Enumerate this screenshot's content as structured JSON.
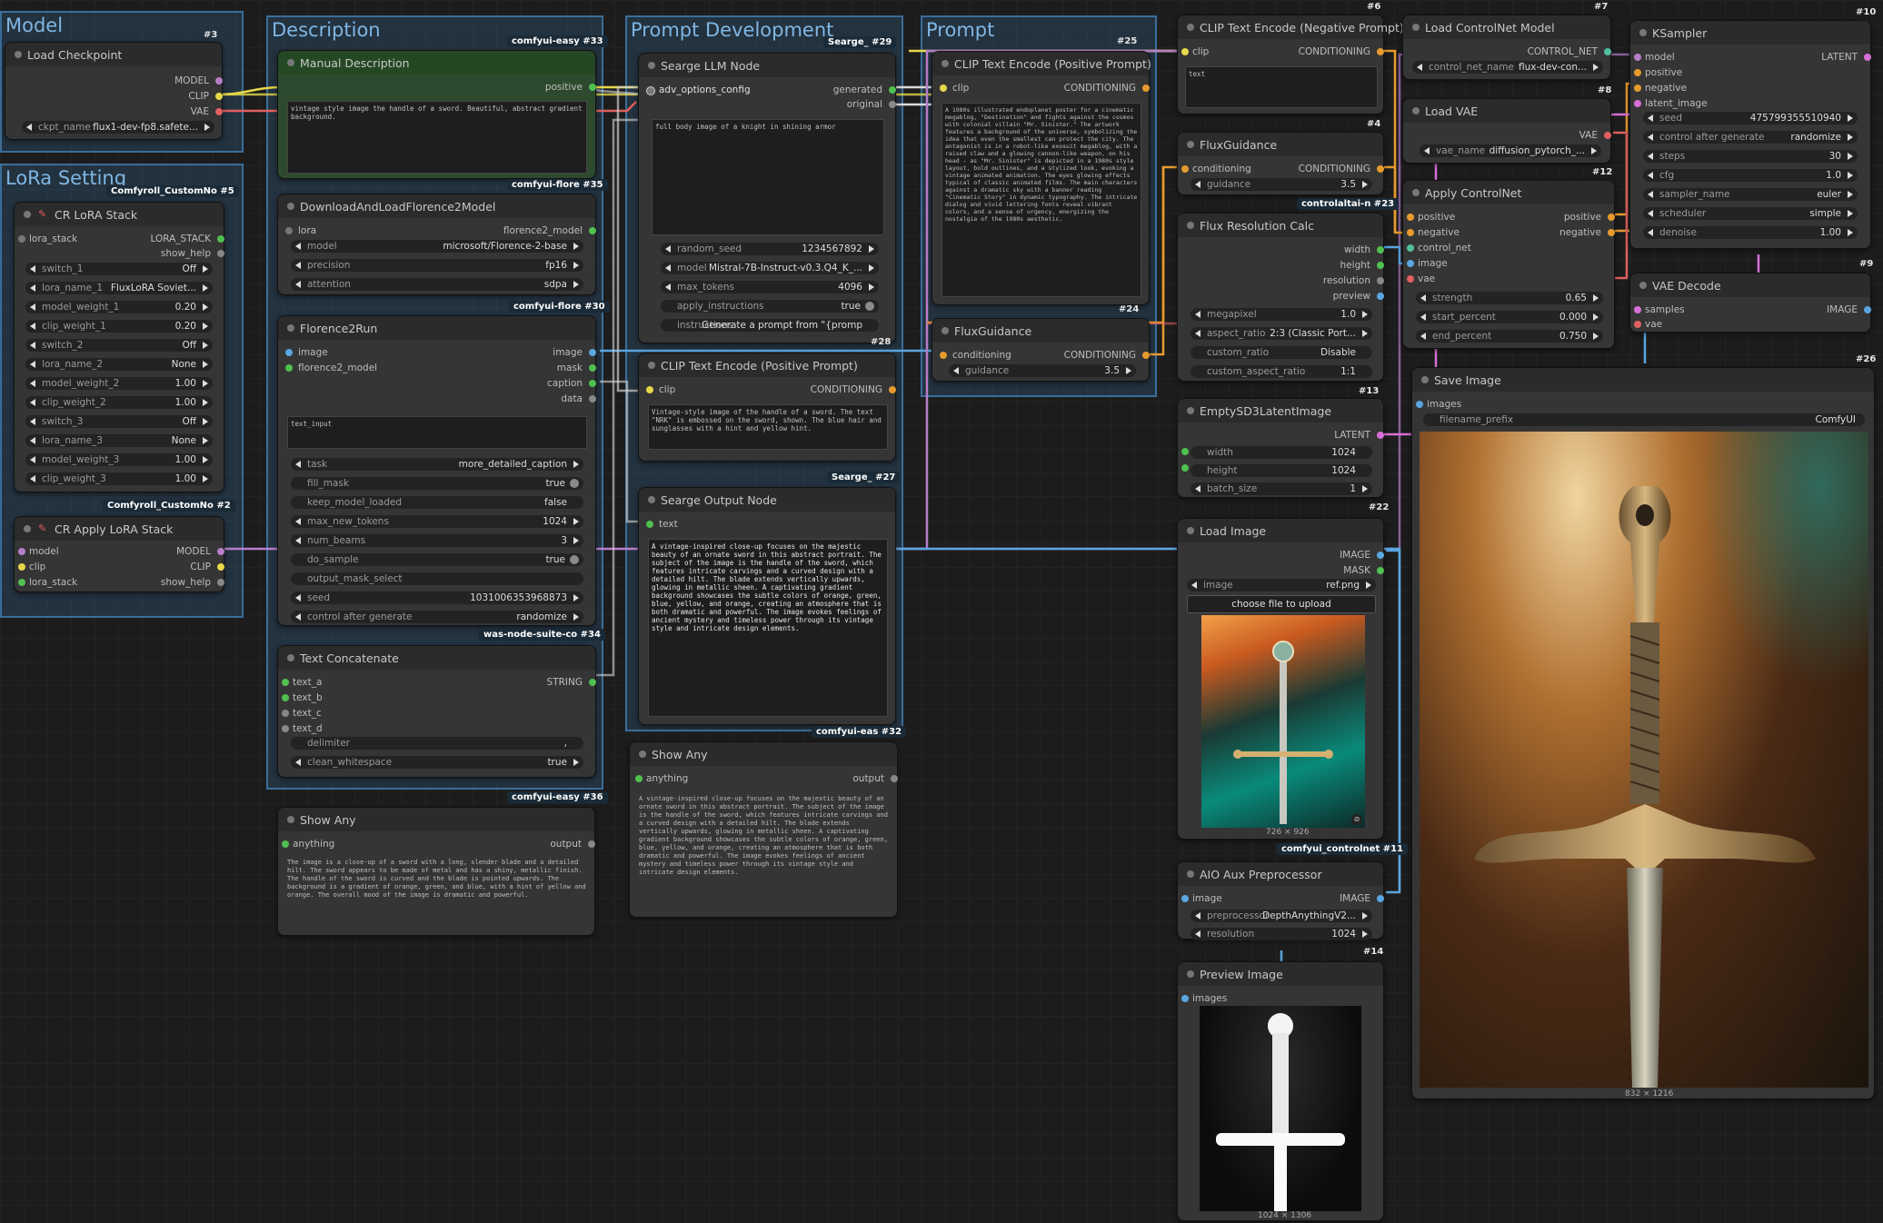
{
  "groups": {
    "model": "Model",
    "lora": "LoRa Setting",
    "description": "Description",
    "prompt_dev": "Prompt Development",
    "prompt": "Prompt"
  },
  "badges": {
    "b3": "#3",
    "b5": "Comfyroll_CustomNo #5",
    "b2": "Comfyroll_CustomNo #2",
    "b33": "comfyui-easy #33",
    "b35": "comfyui-flore #35",
    "b30": "comfyui-flore #30",
    "b34": "was-node-suite-co #34",
    "b36": "comfyui-easy #36",
    "b29": "Searge_ #29",
    "b28": "#28",
    "b27": "Searge_ #27",
    "b32": "comfyui-eas #32",
    "b25": "#25",
    "b24": "#24",
    "b6": "#6",
    "b4": "#4",
    "b23": "controlaltai-n #23",
    "b13": "#13",
    "b22": "#22",
    "b11": "comfyui_controlnet #11",
    "b14": "#14",
    "b7": "#7",
    "b8": "#8",
    "b12": "#12",
    "b10": "#10",
    "b9": "#9",
    "b26": "#26"
  },
  "nodes": {
    "load_checkpoint": {
      "title": "Load Checkpoint",
      "out_model": "MODEL",
      "out_clip": "CLIP",
      "out_vae": "VAE",
      "ckpt_label": "ckpt_name",
      "ckpt_value": "flux1-dev-fp8.safete..."
    },
    "cr_lora_stack": {
      "title": "CR LoRA Stack",
      "in_lora": "lora_stack",
      "out_lora": "LORA_STACK",
      "out_help": "show_help",
      "widgets": [
        [
          "switch_1",
          "Off"
        ],
        [
          "lora_name_1",
          "FluxLoRA Soviet..."
        ],
        [
          "model_weight_1",
          "0.20"
        ],
        [
          "clip_weight_1",
          "0.20"
        ],
        [
          "switch_2",
          "Off"
        ],
        [
          "lora_name_2",
          "None"
        ],
        [
          "model_weight_2",
          "1.00"
        ],
        [
          "clip_weight_2",
          "1.00"
        ],
        [
          "switch_3",
          "Off"
        ],
        [
          "lora_name_3",
          "None"
        ],
        [
          "model_weight_3",
          "1.00"
        ],
        [
          "clip_weight_3",
          "1.00"
        ]
      ]
    },
    "cr_apply_lora": {
      "title": "CR Apply LoRA Stack",
      "in_model": "model",
      "in_clip": "clip",
      "in_lora": "lora_stack",
      "out_model": "MODEL",
      "out_clip": "CLIP",
      "out_help": "show_help"
    },
    "manual_desc": {
      "title": "Manual Description",
      "out": "positive",
      "text": "vintage style image the handle of a sword. Beautiful, abstract gradient background."
    },
    "dl_florence": {
      "title": "DownloadAndLoadFlorence2Model",
      "in_lora": "lora",
      "out": "florence2_model",
      "widgets": [
        [
          "model",
          "microsoft/Florence-2-base"
        ],
        [
          "precision",
          "fp16"
        ],
        [
          "attention",
          "sdpa"
        ]
      ]
    },
    "florence_run": {
      "title": "Florence2Run",
      "in_image": "image",
      "in_model": "florence2_model",
      "out_image": "image",
      "out_mask": "mask",
      "out_caption": "caption",
      "out_data": "data",
      "text_input": "text_input",
      "widgets": [
        [
          "task",
          "more_detailed_caption"
        ],
        [
          "fill_mask",
          "true"
        ],
        [
          "keep_model_loaded",
          "false"
        ],
        [
          "max_new_tokens",
          "1024"
        ],
        [
          "num_beams",
          "3"
        ],
        [
          "do_sample",
          "true"
        ],
        [
          "output_mask_select",
          ""
        ],
        [
          "seed",
          "1031006353968873"
        ],
        [
          "control after generate",
          "randomize"
        ]
      ]
    },
    "text_concat": {
      "title": "Text Concatenate",
      "inputs": [
        "text_a",
        "text_b",
        "text_c",
        "text_d"
      ],
      "out": "STRING",
      "widgets": [
        [
          "delimiter",
          ","
        ],
        [
          "clean_whitespace",
          "true"
        ]
      ]
    },
    "show_any_1": {
      "title": "Show Any",
      "in": "anything",
      "out": "output",
      "text": "The image is a close-up of a sword with a long, slender blade and a detailed hilt. The sword appears to be made of metal and has a shiny, metallic finish. The handle of the sword is curved and the blade is pointed upwards. The background is a gradient of orange, green, and blue, with a hint of yellow and orange. The overall mood of the image is dramatic and powerful."
    },
    "searge_llm": {
      "title": "Searge LLM Node",
      "in_adv": "adv_options_config",
      "out_gen": "generated",
      "out_orig": "original",
      "text": "full body image of a knight in shining armor",
      "widgets": [
        [
          "random_seed",
          "1234567892"
        ],
        [
          "model",
          "Mistral-7B-Instruct-v0.3.Q4_K_..."
        ],
        [
          "max_tokens",
          "4096"
        ],
        [
          "apply_instructions",
          "true"
        ],
        [
          "instructions",
          "Generate a prompt from \"{promp"
        ]
      ]
    },
    "clip_pos_28": {
      "title": "CLIP Text Encode (Positive Prompt)",
      "in_clip": "clip",
      "out": "CONDITIONING",
      "text": "Vintage-style image of the handle of a sword. The text \"NRK\" is embossed on the sword, shown. The blue hair and sunglasses with a hint and yellow hint."
    },
    "searge_out": {
      "title": "Searge Output Node",
      "in": "text",
      "text": "A vintage-inspired close-up focuses on the majestic beauty of an ornate sword in this abstract portrait. The subject of the image is the handle of the sword, which features intricate carvings and a curved design with a detailed hilt. The blade extends vertically upwards, glowing in metallic sheen. A captivating gradient background showcases the subtle colors of orange, green, blue, yellow, and orange, creating an atmosphere that is both dramatic and powerful. The image evokes feelings of ancient mystery and timeless power through its vintage style and intricate design elements."
    },
    "show_any_2": {
      "title": "Show Any",
      "in": "anything",
      "out": "output",
      "text": "A vintage-inspired close-up focuses on the majestic beauty of an ornate sword in this abstract portrait. The subject of the image is the handle of the sword, which features intricate carvings and a curved design with a detailed hilt. The blade extends vertically upwards, glowing in metallic sheen. A captivating gradient background showcases the subtle colors of orange, green, blue, yellow, and orange, creating an atmosphere that is both dramatic and powerful. The image evokes feelings of ancient mystery and timeless power through its vintage style and intricate design elements."
    },
    "clip_pos_25": {
      "title": "CLIP Text Encode (Positive Prompt)",
      "in_clip": "clip",
      "out": "CONDITIONING",
      "text": "A 1980s illustrated endoplanet poster for a cinematic megablog, \"Destination\" and fights against the cosmos with colonial villain \"Mr. Sinister.\" The artwork features a background of the universe, symbolizing the idea that even the smallest can protect the city. The antagonist is in a robot-like exosuit megablog, with a raised claw and a glowing cannon-like weapon, on his head - as \"Mr. Sinister\" is depicted in a 1980s style layout, bold outlines, and a stylized look, evoking a vintage animated animation. The eyes glowing effects typical of classic animated films. The main characters against a dramatic sky with a banner reading \"Cinematic Story\" in dynamic typography. The intricate dialog and vivid lettering fonts reveal vibrant colors, and a sense of urgency, energizing the nostalgia of the 1980s aesthetic."
    },
    "flux_guidance_24": {
      "title": "FluxGuidance",
      "in": "conditioning",
      "out": "CONDITIONING",
      "w_label": "guidance",
      "w_value": "3.5"
    },
    "clip_neg": {
      "title": "CLIP Text Encode (Negative Prompt)",
      "in_clip": "clip",
      "out": "CONDITIONING",
      "text": "text"
    },
    "flux_guidance_4": {
      "title": "FluxGuidance",
      "in": "conditioning",
      "out": "CONDITIONING",
      "w_label": "guidance",
      "w_value": "3.5"
    },
    "flux_res": {
      "title": "Flux Resolution Calc",
      "out_width": "width",
      "out_height": "height",
      "out_res": "resolution",
      "out_preview": "preview",
      "widgets": [
        [
          "megapixel",
          "1.0"
        ],
        [
          "aspect_ratio",
          "2:3 (Classic Port..."
        ],
        [
          "custom_ratio",
          "Disable"
        ],
        [
          "custom_aspect_ratio",
          "1:1"
        ]
      ]
    },
    "empty_latent": {
      "title": "EmptySD3LatentImage",
      "out": "LATENT",
      "widgets": [
        [
          "width",
          "1024"
        ],
        [
          "height",
          "1024"
        ],
        [
          "batch_size",
          "1"
        ]
      ]
    },
    "load_image": {
      "title": "Load Image",
      "out_image": "IMAGE",
      "out_mask": "MASK",
      "w_label": "image",
      "w_value": "ref.png",
      "upload": "choose file to upload",
      "size": "726 × 926"
    },
    "aio_aux": {
      "title": "AIO Aux Preprocessor",
      "in": "image",
      "out": "IMAGE",
      "widgets": [
        [
          "preprocessor",
          "DepthAnythingV2..."
        ],
        [
          "resolution",
          "1024"
        ]
      ]
    },
    "preview_image": {
      "title": "Preview Image",
      "in": "images",
      "size": "1024 × 1306"
    },
    "load_controlnet": {
      "title": "Load ControlNet Model",
      "out": "CONTROL_NET",
      "w_label": "control_net_name",
      "w_value": "flux-dev-con..."
    },
    "load_vae": {
      "title": "Load VAE",
      "out": "VAE",
      "w_label": "vae_name",
      "w_value": "diffusion_pytorch_..."
    },
    "apply_controlnet": {
      "title": "Apply ControlNet",
      "inputs": [
        "positive",
        "negative",
        "control_net",
        "image",
        "vae"
      ],
      "out_pos": "positive",
      "out_neg": "negative",
      "widgets": [
        [
          "strength",
          "0.65"
        ],
        [
          "start_percent",
          "0.000"
        ],
        [
          "end_percent",
          "0.750"
        ]
      ]
    },
    "ksampler": {
      "title": "KSampler",
      "inputs": [
        "model",
        "positive",
        "negative",
        "latent_image"
      ],
      "out": "LATENT",
      "widgets": [
        [
          "seed",
          "475799355510940"
        ],
        [
          "control after generate",
          "randomize"
        ],
        [
          "steps",
          "30"
        ],
        [
          "cfg",
          "1.0"
        ],
        [
          "sampler_name",
          "euler"
        ],
        [
          "scheduler",
          "simple"
        ],
        [
          "denoise",
          "1.00"
        ]
      ]
    },
    "vae_decode": {
      "title": "VAE Decode",
      "in_samples": "samples",
      "in_vae": "vae",
      "out": "IMAGE"
    },
    "save_image": {
      "title": "Save Image",
      "in": "images",
      "w_label": "filename_prefix",
      "w_value": "ComfyUI",
      "size": "832 × 1216"
    }
  }
}
